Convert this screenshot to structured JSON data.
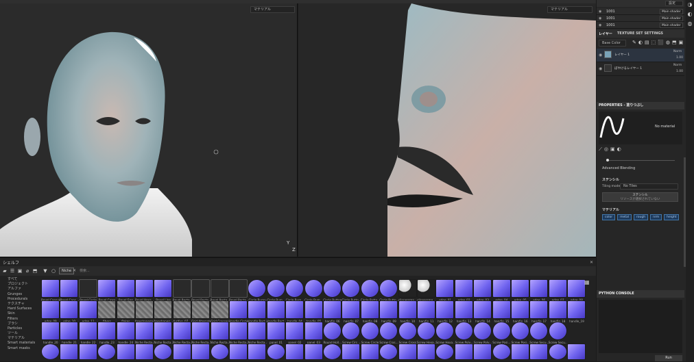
{
  "viewport3d": {
    "material_select": "マテリアル",
    "axis_z": "Z",
    "axis_y": "Y"
  },
  "viewport2d": {
    "material_select": "マテリアル"
  },
  "shelf": {
    "title": "シェルフ",
    "search_tag": "Niche",
    "search_placeholder": "検索...",
    "categories": [
      "すべて",
      "プロジェクト",
      "アルファ",
      "Grunges",
      "Procedurals",
      "テクスチャ",
      "Hard Surfaces",
      "Skin",
      "Filters",
      "ブラシ",
      "Particles",
      "ツール",
      "マテリアル",
      "Smart materials",
      "Smart masks"
    ],
    "row1": [
      "Bevel Capsule",
      "Bevel Caps...",
      "Bevel Circle",
      "Bevel Cross",
      "Bevel Egg",
      "Bevel Hexa...",
      "Bevel Line",
      "Bevel Recta...",
      "Bevel Recta...",
      "Bevel Recta...",
      "Bevel Recta...",
      "Circle Bump",
      "Circle Bum...",
      "Circle Bum...",
      "Circle Bum...",
      "Circle Button",
      "Circle Butto...",
      "Circle Butto...",
      "Circle Butto...",
      "clippersma...",
      "clippersma...",
      "edge_01",
      "edge_02",
      "edge_03",
      "edge_04",
      "edge_05",
      "edge_06",
      "edge_07",
      "edge_08"
    ],
    "row2": [
      "edge_09",
      "edge_10",
      "edge_11",
      "fibers",
      "flakes",
      "freeshapega...",
      "freeshapeg...",
      "fur/fun_07...",
      "Grid Alternate",
      "Grid Crosses",
      "Handle Circle",
      "Handle Rect...",
      "Handle Rect...",
      "handle_04",
      "handle_05",
      "handle_06",
      "handle_07",
      "handle_08",
      "handle_09",
      "handle_10",
      "handle_11",
      "handle_12",
      "handle_13",
      "handle_14",
      "handle_15",
      "handle_16",
      "handle_17",
      "handle_18",
      "handle_19"
    ],
    "row3": [
      "handle_20",
      "handle_21",
      "handle_22",
      "handle_23",
      "handle_24",
      "Niche Recta...",
      "Niche Recta...",
      "Niche Recta...",
      "Niche Recta...",
      "Niche Recta...",
      "Niche Recta...",
      "Niche Recta...",
      "panel_01",
      "panel_02",
      "panel_03",
      "Round Holl...",
      "Screw Circ...",
      "Screw Circle",
      "Screw Cros...",
      "Screw Cross",
      "Screw Hexa...",
      "Screw Hexa...",
      "Screw Poly...",
      "Screw Poly...",
      "Screw Posi...",
      "Screw Posi...",
      "Screw Secu...",
      "Screw Secu..."
    ]
  },
  "right_panel": {
    "top_dropdown": "設定",
    "texture_sets": [
      {
        "name": "1001",
        "shader": "Main shader"
      },
      {
        "name": "1001",
        "shader": "Main shader"
      },
      {
        "name": "1001",
        "shader": "Main shader"
      }
    ],
    "tabs": [
      "レイヤー",
      "TEXTURE SET SETTINGS"
    ],
    "channel_select": "Base Color",
    "layers": [
      {
        "name": "レイヤー 1",
        "blend": "Norm",
        "opacity": "1.00"
      },
      {
        "name": "ぼやけるレイヤー 1",
        "blend": "Norm",
        "opacity": "1.00"
      }
    ],
    "properties_title": "PROPERTIES - 塗りつぶし",
    "no_material": "No material",
    "advanced_blending": "Advanced Blending",
    "stencil_title": "ステンシル",
    "tiling_label": "Tiling mode",
    "tiling_value": "No Tiles",
    "stencil_button": "ステンシル",
    "stencil_button_sub": "リソースが選択されていない",
    "material_section": "マテリアル",
    "material_pills": [
      "color",
      "metal",
      "rough",
      "nrm",
      "height"
    ],
    "python_console": "PYTHON CONSOLE",
    "run_button": "Run"
  }
}
